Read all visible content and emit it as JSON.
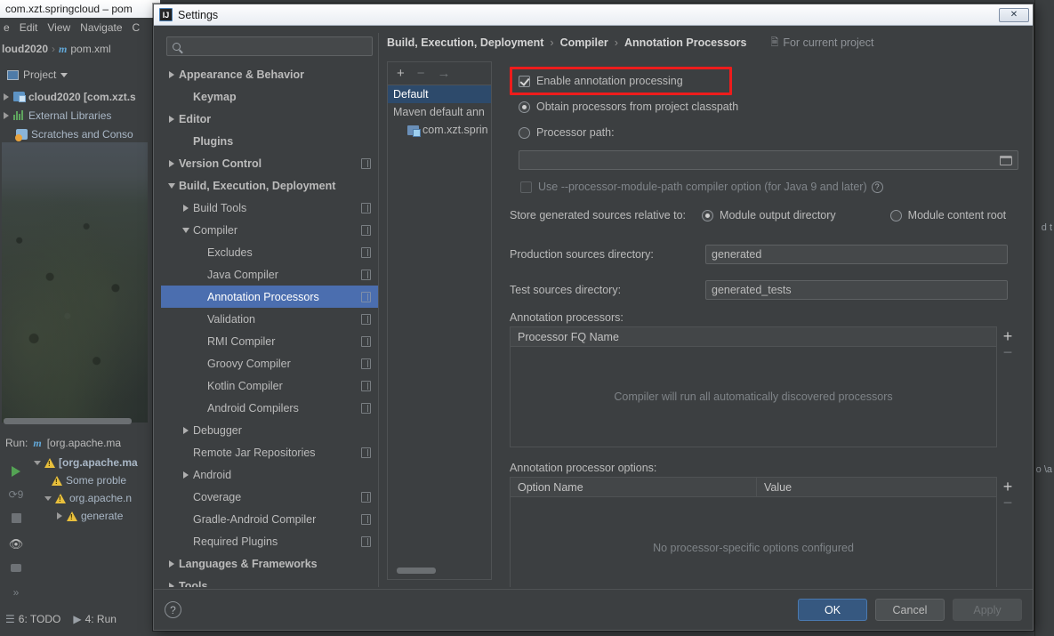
{
  "ide": {
    "window_title": "com.xzt.springcloud – pom",
    "menu": [
      "e",
      "Edit",
      "View",
      "Navigate",
      "C"
    ],
    "breadcrumb": {
      "project": "loud2020",
      "file": "pom.xml",
      "file_icon": "maven-m-icon"
    },
    "project_tool": {
      "label": "Project",
      "icon": "project-panel-icon",
      "chevron": "chevron-down-icon"
    },
    "project_tree": [
      {
        "label": "cloud2020 [com.xzt.s",
        "icon": "folder-icon",
        "arrow": "chevron-right-icon"
      },
      {
        "label": "External Libraries",
        "icon": "libraries-icon",
        "arrow": "chevron-right-icon"
      },
      {
        "label": "Scratches and Conso",
        "icon": "scratches-icon",
        "arrow": ""
      }
    ],
    "run_panel": {
      "label": "Run:",
      "config": "[org.apache.ma",
      "config_icon": "maven-m-icon",
      "rows": [
        {
          "label": "[org.apache.ma",
          "icon": "warning-icon",
          "arrow": "chevron-down-icon",
          "indent": 0,
          "bold": true
        },
        {
          "label": "Some proble",
          "icon": "warning-icon",
          "arrow": "",
          "indent": 1,
          "bold": false
        },
        {
          "label": "org.apache.n",
          "icon": "warning-icon",
          "arrow": "chevron-down-icon",
          "indent": 1,
          "bold": false
        },
        {
          "label": "generate",
          "icon": "warning-icon",
          "arrow": "chevron-right-icon",
          "indent": 2,
          "bold": false
        }
      ]
    },
    "gutter_icons": [
      "run-icon",
      "rerun-icon",
      "stop-icon",
      "eye-icon",
      "camera-icon",
      "expand-icon"
    ],
    "status_bar": [
      {
        "label": "6: TODO",
        "icon": "todo-icon"
      },
      {
        "label": "4: Run",
        "icon": "run-icon"
      }
    ],
    "right_edge_fragments": [
      "d  t",
      "o \\a"
    ]
  },
  "dialog": {
    "title": "Settings",
    "logo_text": "IJ",
    "close_icon": "close-icon",
    "search": {
      "placeholder": "",
      "value": "",
      "icon": "search-icon"
    },
    "tree": [
      {
        "label": "Appearance & Behavior",
        "arrow": "right",
        "bold": true,
        "indent": 0,
        "badge": false,
        "selected": false
      },
      {
        "label": "Keymap",
        "arrow": "none",
        "bold": true,
        "indent": 1,
        "badge": false,
        "selected": false
      },
      {
        "label": "Editor",
        "arrow": "right",
        "bold": true,
        "indent": 0,
        "badge": false,
        "selected": false
      },
      {
        "label": "Plugins",
        "arrow": "none",
        "bold": true,
        "indent": 1,
        "badge": false,
        "selected": false
      },
      {
        "label": "Version Control",
        "arrow": "right",
        "bold": true,
        "indent": 0,
        "badge": true,
        "selected": false
      },
      {
        "label": "Build, Execution, Deployment",
        "arrow": "down",
        "bold": true,
        "indent": 0,
        "badge": false,
        "selected": false
      },
      {
        "label": "Build Tools",
        "arrow": "right",
        "bold": false,
        "indent": 1,
        "badge": true,
        "selected": false
      },
      {
        "label": "Compiler",
        "arrow": "down",
        "bold": false,
        "indent": 1,
        "badge": true,
        "selected": false
      },
      {
        "label": "Excludes",
        "arrow": "none",
        "bold": false,
        "indent": 2,
        "badge": true,
        "selected": false
      },
      {
        "label": "Java Compiler",
        "arrow": "none",
        "bold": false,
        "indent": 2,
        "badge": true,
        "selected": false
      },
      {
        "label": "Annotation Processors",
        "arrow": "none",
        "bold": false,
        "indent": 2,
        "badge": true,
        "selected": true
      },
      {
        "label": "Validation",
        "arrow": "none",
        "bold": false,
        "indent": 2,
        "badge": true,
        "selected": false
      },
      {
        "label": "RMI Compiler",
        "arrow": "none",
        "bold": false,
        "indent": 2,
        "badge": true,
        "selected": false
      },
      {
        "label": "Groovy Compiler",
        "arrow": "none",
        "bold": false,
        "indent": 2,
        "badge": true,
        "selected": false
      },
      {
        "label": "Kotlin Compiler",
        "arrow": "none",
        "bold": false,
        "indent": 2,
        "badge": true,
        "selected": false
      },
      {
        "label": "Android Compilers",
        "arrow": "none",
        "bold": false,
        "indent": 2,
        "badge": true,
        "selected": false
      },
      {
        "label": "Debugger",
        "arrow": "right",
        "bold": false,
        "indent": 1,
        "badge": false,
        "selected": false
      },
      {
        "label": "Remote Jar Repositories",
        "arrow": "none",
        "bold": false,
        "indent": 1,
        "badge": true,
        "selected": false
      },
      {
        "label": "Android",
        "arrow": "right",
        "bold": false,
        "indent": 1,
        "badge": false,
        "selected": false
      },
      {
        "label": "Coverage",
        "arrow": "none",
        "bold": false,
        "indent": 1,
        "badge": true,
        "selected": false
      },
      {
        "label": "Gradle-Android Compiler",
        "arrow": "none",
        "bold": false,
        "indent": 1,
        "badge": true,
        "selected": false
      },
      {
        "label": "Required Plugins",
        "arrow": "none",
        "bold": false,
        "indent": 1,
        "badge": true,
        "selected": false
      },
      {
        "label": "Languages & Frameworks",
        "arrow": "right",
        "bold": true,
        "indent": 0,
        "badge": false,
        "selected": false
      },
      {
        "label": "Tools",
        "arrow": "right",
        "bold": true,
        "indent": 0,
        "badge": false,
        "selected": false
      }
    ],
    "breadcrumbs": [
      "Build, Execution, Deployment",
      "Compiler",
      "Annotation Processors"
    ],
    "breadcrumb_sep": "›",
    "scope_note": {
      "label": "For current project",
      "icon": "project-scope-icon"
    },
    "profiles": {
      "toolbar": {
        "add": "+",
        "remove": "−",
        "move": "→"
      },
      "items": [
        {
          "label": "Default",
          "selected": true,
          "icon": "",
          "child": false
        },
        {
          "label": "Maven default ann",
          "selected": false,
          "icon": "",
          "child": false
        },
        {
          "label": "com.xzt.sprin",
          "selected": false,
          "icon": "module-icon",
          "child": true
        }
      ]
    },
    "options": {
      "enable_annotation_processing": {
        "label": "Enable annotation processing",
        "checked": true,
        "highlighted": true
      },
      "source_mode": {
        "selected": "obtain",
        "obtain_label": "Obtain processors from project classpath",
        "path_label": "Processor path:",
        "path_value": "",
        "browse_icon": "folder-browse-icon"
      },
      "module_path_option": {
        "label": "Use --processor-module-path compiler option (for Java 9 and later)",
        "checked": false,
        "help_icon": "help-icon"
      },
      "store_relative": {
        "label": "Store generated sources relative to:",
        "options": [
          "Module output directory",
          "Module content root"
        ],
        "selected": "Module output directory"
      },
      "production_sources": {
        "label": "Production sources directory:",
        "value": "generated"
      },
      "test_sources": {
        "label": "Test sources directory:",
        "value": "generated_tests"
      },
      "processors_table": {
        "label": "Annotation processors:",
        "columns": [
          "Processor FQ Name"
        ],
        "empty_text": "Compiler will run all automatically discovered processors",
        "add_icon": "plus-icon",
        "remove_icon": "minus-icon"
      },
      "processor_options_table": {
        "label": "Annotation processor options:",
        "columns": [
          "Option Name",
          "Value"
        ],
        "empty_text": "No processor-specific options configured",
        "add_icon": "plus-icon",
        "remove_icon": "minus-icon"
      }
    },
    "footer": {
      "help": "?",
      "ok": "OK",
      "cancel": "Cancel",
      "apply": "Apply"
    },
    "colors": {
      "accent_selection": "#4b6eaf",
      "highlight_red": "#ee1c1c",
      "primary_button": "#365880",
      "panel_bg": "#3c3f41",
      "field_bg": "#45484a"
    }
  }
}
